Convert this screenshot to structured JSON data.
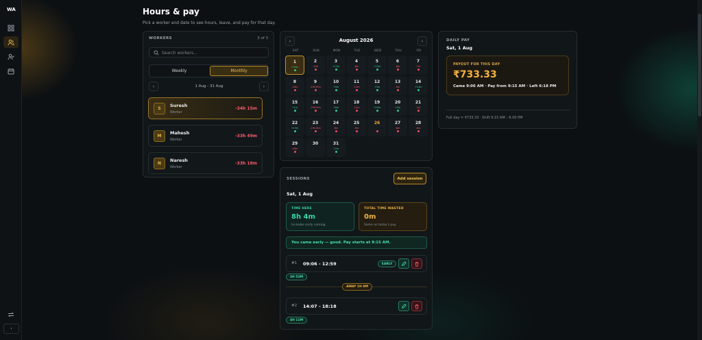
{
  "app": {
    "logo": "WA"
  },
  "page": {
    "title": "Hours & pay",
    "subtitle": "Pick a worker and date to see hours, leave, and pay for that day."
  },
  "workers_panel": {
    "label": "WORKERS",
    "count": "3 of 3",
    "search_placeholder": "Search workers...",
    "toggle": {
      "weekly": "Weekly",
      "monthly": "Monthly",
      "selected": "Monthly"
    },
    "range": "1 Aug - 31 Aug",
    "workers": [
      {
        "initial": "S",
        "name": "Suresh",
        "role": "Worker",
        "hours": "-34h 15m",
        "selected": true
      },
      {
        "initial": "M",
        "name": "Mahesh",
        "role": "Worker",
        "hours": "-33h 49m",
        "selected": false
      },
      {
        "initial": "N",
        "name": "Naresh",
        "role": "Worker",
        "hours": "-33h 18m",
        "selected": false
      }
    ]
  },
  "calendar": {
    "month": "August 2026",
    "weekdays": [
      "SAT",
      "SUN",
      "MON",
      "TUE",
      "WED",
      "THU",
      "FRI"
    ],
    "days": [
      {
        "n": "1",
        "h": "+32m",
        "g": true,
        "sel": true
      },
      {
        "n": "2",
        "h": "-19h"
      },
      {
        "n": "3",
        "h": "+13m",
        "g": true
      },
      {
        "n": "4",
        "h": "-6m"
      },
      {
        "n": "5",
        "h": "+10m",
        "g": true
      },
      {
        "n": "6",
        "h": "-6m"
      },
      {
        "n": "7",
        "h": "-7m"
      },
      {
        "n": "8",
        "h": "-18m"
      },
      {
        "n": "9",
        "h": "-19h15m"
      },
      {
        "n": "10",
        "h": "+9m",
        "g": true
      },
      {
        "n": "11",
        "h": "-12m"
      },
      {
        "n": "12",
        "h": "+3m",
        "g": true
      },
      {
        "n": "13",
        "h": "-5m"
      },
      {
        "n": "14",
        "h": "+14m",
        "g": true
      },
      {
        "n": "15",
        "h": "+1m",
        "g": true
      },
      {
        "n": "16",
        "h": "-19h15m"
      },
      {
        "n": "17",
        "h": "+8m",
        "g": true
      },
      {
        "n": "18",
        "h": "-12m"
      },
      {
        "n": "19",
        "h": "+20m",
        "g": true
      },
      {
        "n": "20",
        "h": "+5m",
        "g": true
      },
      {
        "n": "21",
        "h": "-2m"
      },
      {
        "n": "22",
        "h": "+13m",
        "g": true
      },
      {
        "n": "23",
        "h": "-19h15m"
      },
      {
        "n": "24",
        "h": "-8m"
      },
      {
        "n": "25",
        "h": "-9m"
      },
      {
        "n": "26",
        "h": "",
        "today": true
      },
      {
        "n": "27",
        "h": "-8m"
      },
      {
        "n": "28",
        "h": "-6m"
      },
      {
        "n": "29",
        "h": "-16m"
      },
      {
        "n": "30",
        "h": "",
        "nodot": true
      },
      {
        "n": "31",
        "h": "+2m",
        "g": true
      }
    ]
  },
  "sessions": {
    "label": "SESSIONS",
    "add_label": "Add session",
    "date": "Sat, 1 Aug",
    "time_here": {
      "title": "TIME HERE",
      "value": "8h 4m",
      "sub": "Includes early coming"
    },
    "time_wasted": {
      "title": "TOTAL TIME WASTED",
      "value": "0m",
      "sub": "Same as today's pay"
    },
    "message": "You came early — good. Pay starts at 9:15 AM.",
    "rows": [
      {
        "num": "#1",
        "time": "09:06 - 12:59",
        "badge": "EARLY",
        "duration": "3H 53M"
      },
      {
        "num": "#2",
        "time": "14:07 - 18:18",
        "badge": "",
        "duration": "4H 11M"
      }
    ],
    "away": "AWAY 1H 8M"
  },
  "daily_pay": {
    "label": "DAILY PAY",
    "date": "Sat, 1 Aug",
    "box_title": "PAYOUT FOR THIS DAY",
    "amount": "₹733.33",
    "summary": "Came 9:06 AM · Pay from 9:15 AM · Left 6:18 PM",
    "footer": "Full day = ₹733.33 · Shift 9:15 AM – 6:00 PM"
  },
  "colors": {
    "accent": "#f0b447",
    "positive": "#36d8a4",
    "negative": "#ff5c6c"
  }
}
